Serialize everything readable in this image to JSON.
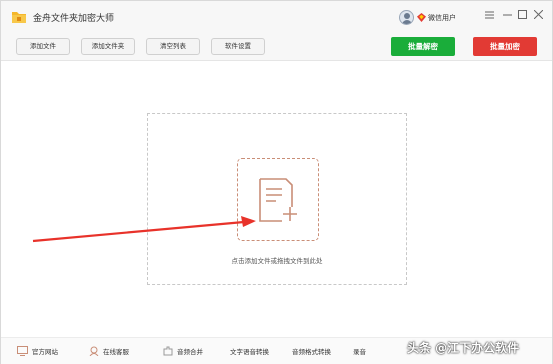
{
  "app": {
    "title": "金舟文件夹加密大师",
    "user": "微信用户"
  },
  "toolbar": {
    "add_file": "添加文件",
    "add_folder": "添加文件夹",
    "clear_list": "清空列表",
    "settings": "软件设置",
    "batch_decrypt": "批量解密",
    "batch_encrypt": "批量加密"
  },
  "main": {
    "drop_hint": "点击添加文件或拖拽文件到此处"
  },
  "footer": {
    "website": "官方网站",
    "service": "在线客服",
    "audio_merge": "音频合并",
    "tts": "文字语音转换",
    "video_convert": "音频格式转换",
    "record": "录音"
  },
  "watermark": "头条 @江下办公软件",
  "colors": {
    "decrypt": "#1aad3a",
    "encrypt": "#e23a34",
    "accent": "#c98e77",
    "arrow": "#e8322a"
  }
}
